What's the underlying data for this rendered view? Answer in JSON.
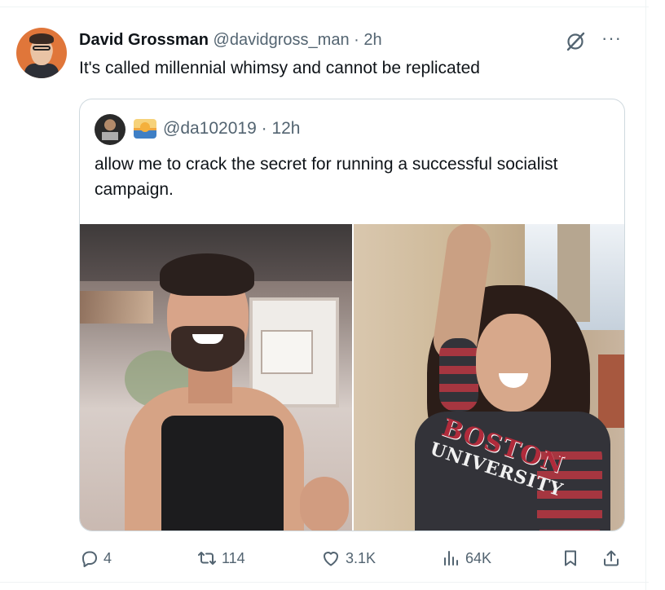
{
  "tweet": {
    "author_name": "David Grossman",
    "handle": "@davidgross_man",
    "separator": "·",
    "time": "2h",
    "text": "It's called millennial whimsy and cannot be replicated"
  },
  "quote": {
    "handle": "@da102019",
    "separator": "·",
    "time": "12h",
    "text": "allow me to crack the secret for running a successful socialist campaign.",
    "right_photo_shirt_line1": "BOSTON",
    "right_photo_shirt_line2": "UNIVERSITY"
  },
  "actions": {
    "replies": "4",
    "retweets": "114",
    "likes": "3.1K",
    "views": "64K"
  },
  "icons": {
    "avatar": "avatar",
    "more": "more-icon",
    "grok": "grok-icon",
    "reply": "reply-icon",
    "retweet": "retweet-icon",
    "like": "heart-icon",
    "views": "views-icon",
    "bookmark": "bookmark-icon",
    "share": "share-icon"
  },
  "colors": {
    "text_primary": "#0f1419",
    "text_secondary": "#536471",
    "border": "#cfd9de"
  }
}
